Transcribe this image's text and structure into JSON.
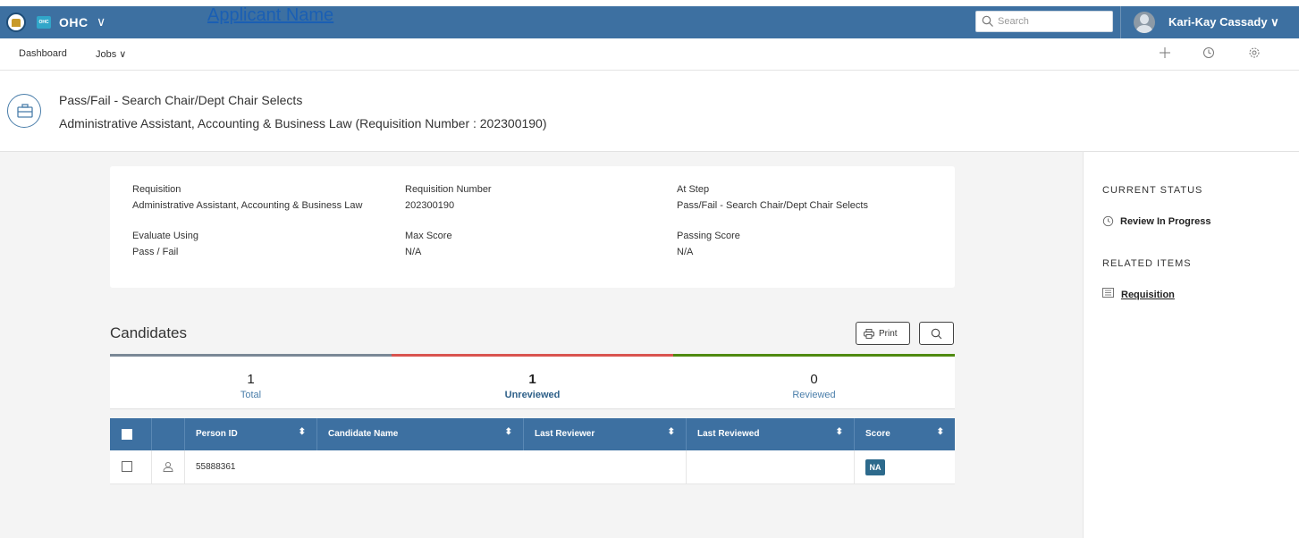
{
  "topbar": {
    "app_badge": "OHC",
    "app_name": "OHC",
    "app_chevron": "∨",
    "search_placeholder": "Search",
    "user_name": "Kari-Kay Cassady ∨"
  },
  "subnav": {
    "dashboard": "Dashboard",
    "jobs": "Jobs ∨",
    "icons": [
      "plus-icon",
      "clock-icon",
      "gear-icon"
    ]
  },
  "header": {
    "line1": "Pass/Fail - Search Chair/Dept Chair Selects",
    "line2": "Administrative Assistant, Accounting & Business Law (Requisition Number : 202300190)"
  },
  "info": {
    "requisition_label": "Requisition",
    "requisition_value": "Administrative Assistant, Accounting & Business Law",
    "req_number_label": "Requisition Number",
    "req_number_value": "202300190",
    "at_step_label": "At Step",
    "at_step_value": "Pass/Fail - Search Chair/Dept Chair Selects",
    "evaluate_label": "Evaluate Using",
    "evaluate_value": "Pass / Fail",
    "max_score_label": "Max Score",
    "max_score_value": "N/A",
    "passing_label": "Passing Score",
    "passing_value": "N/A"
  },
  "candidates": {
    "title": "Candidates",
    "print_label": "Print",
    "stats": [
      {
        "count": "1",
        "label": "Total",
        "color": "#7a8896"
      },
      {
        "count": "1",
        "label": "Unreviewed",
        "color": "#d9534f"
      },
      {
        "count": "0",
        "label": "Reviewed",
        "color": "#4f8a10"
      }
    ],
    "columns": [
      "Person ID",
      "Candidate Name",
      "Last Reviewer",
      "Last Reviewed",
      "Score"
    ],
    "sort_glyph": "⬍",
    "rows": [
      {
        "person_id": "55888361",
        "candidate_name": "Applicant Name",
        "last_reviewer": "",
        "last_reviewed": "",
        "score": "NA"
      }
    ]
  },
  "sidebar": {
    "current_status_heading": "CURRENT STATUS",
    "current_status_value": "Review In Progress",
    "related_heading": "RELATED ITEMS",
    "related_link": "Requisition"
  },
  "colors": {
    "primary": "#3d70a1",
    "link": "#1a5fb4",
    "badge": "#2d6a8c"
  }
}
